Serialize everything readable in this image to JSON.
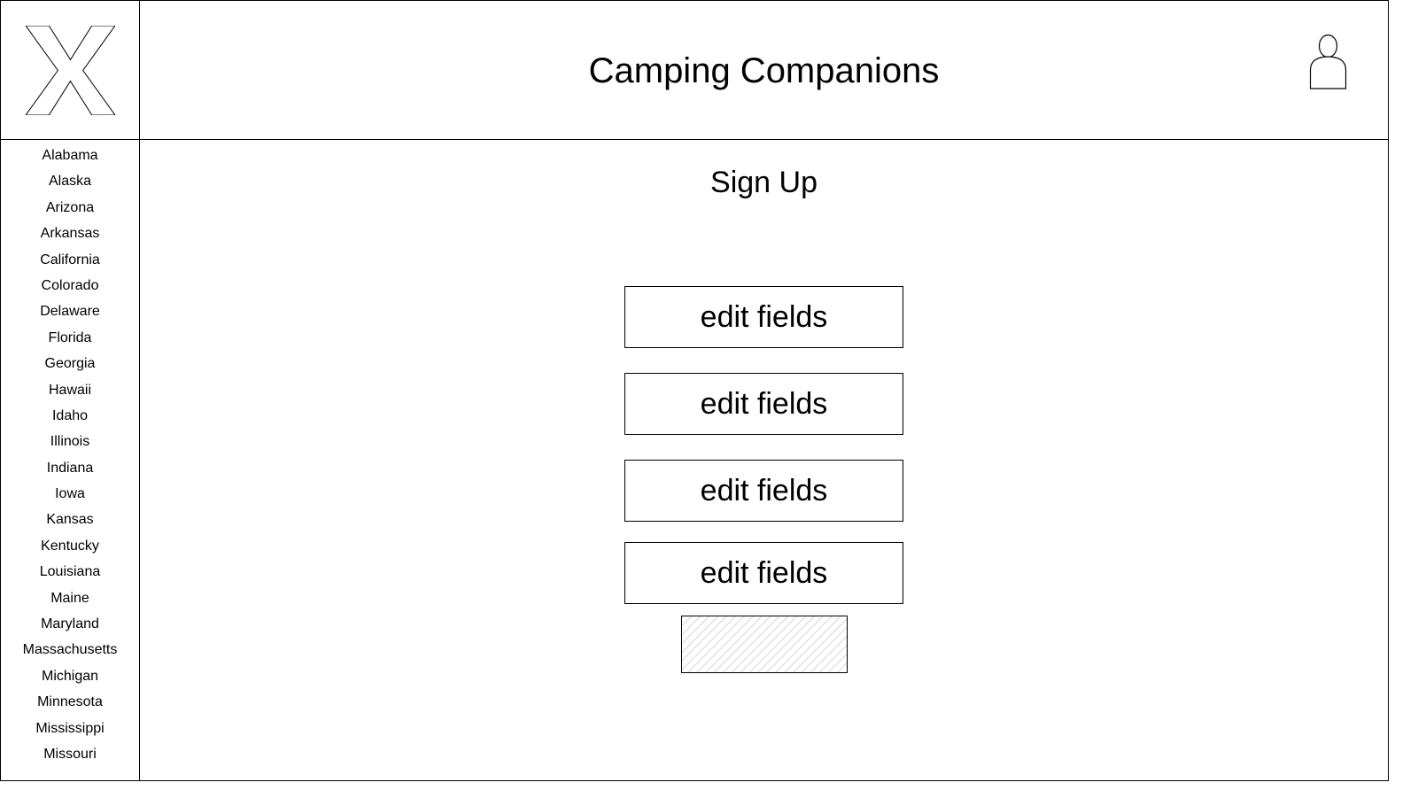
{
  "header": {
    "logo_icon": "x-logo-icon",
    "title": "Camping Companions",
    "user_icon": "user-icon"
  },
  "sidebar": {
    "states": [
      "Alabama",
      "Alaska",
      "Arizona",
      "Arkansas",
      "California",
      "Colorado",
      "Delaware",
      "Florida",
      "Georgia",
      "Hawaii",
      "Idaho",
      "Illinois",
      "Indiana",
      "Iowa",
      "Kansas",
      "Kentucky",
      "Louisiana",
      "Maine",
      "Maryland",
      "Massachusetts",
      "Michigan",
      "Minnesota",
      "Mississippi",
      "Missouri"
    ]
  },
  "main": {
    "heading": "Sign Up",
    "fields": [
      {
        "label": "edit fields"
      },
      {
        "label": "edit fields"
      },
      {
        "label": "edit fields"
      },
      {
        "label": "edit fields"
      }
    ],
    "submit_placeholder": "image-placeholder"
  }
}
